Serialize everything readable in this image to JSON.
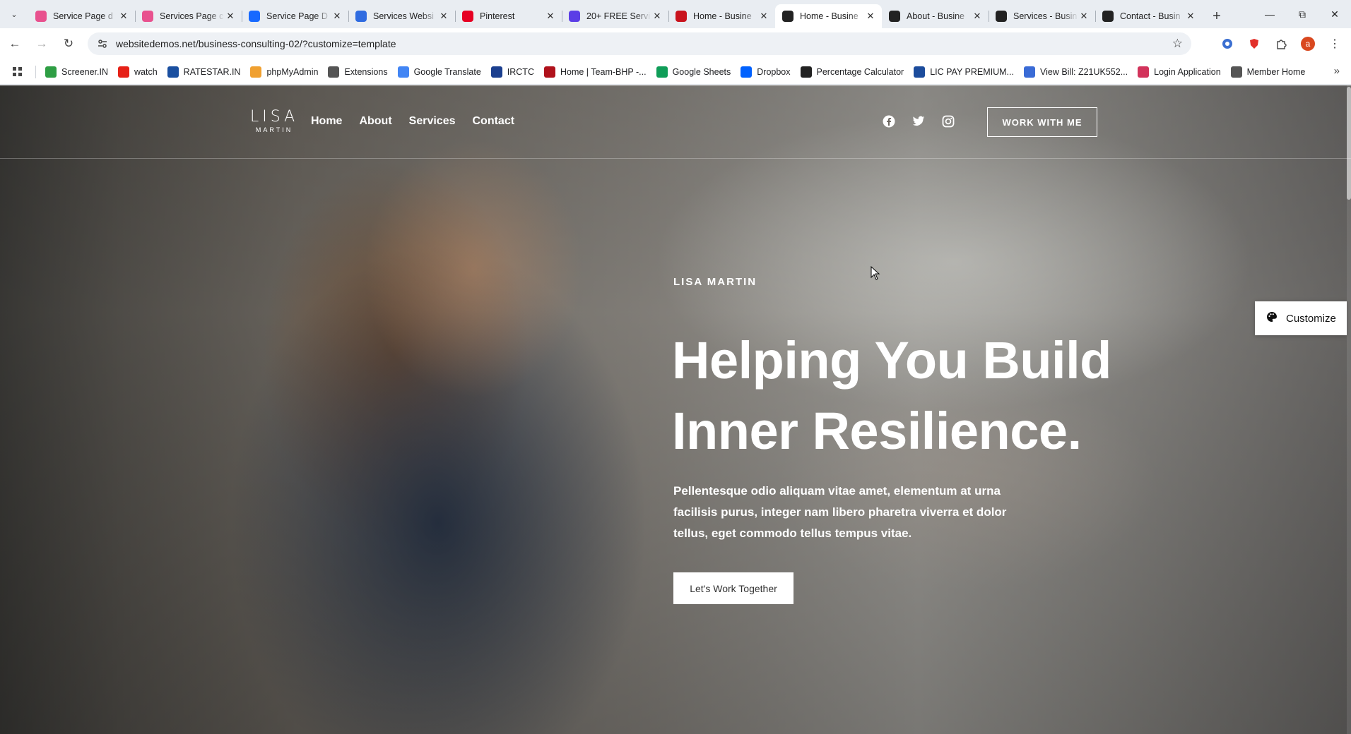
{
  "browser": {
    "tabs": [
      {
        "title": "Service Page d",
        "favicon_color": "#e8518e",
        "icon": "dribbble-icon"
      },
      {
        "title": "Services Page c",
        "favicon_color": "#e8518e",
        "icon": "dribbble-icon"
      },
      {
        "title": "Service Page D",
        "favicon_color": "#1769ff",
        "icon": "behance-icon"
      },
      {
        "title": "Services Websi",
        "favicon_color": "#2f6be0",
        "icon": "n-icon"
      },
      {
        "title": "Pinterest",
        "favicon_color": "#e60023",
        "icon": "pinterest-icon"
      },
      {
        "title": "20+ FREE Servi",
        "favicon_color": "#5b3ee6",
        "icon": "a-icon"
      },
      {
        "title": "Home - Busine",
        "favicon_color": "#c9131d",
        "icon": "n-red-icon"
      },
      {
        "title": "Home - Busine",
        "favicon_color": "#222222",
        "icon": "m-icon",
        "active": true
      },
      {
        "title": "About - Busine",
        "favicon_color": "#222222",
        "icon": "m-icon"
      },
      {
        "title": "Services - Busin",
        "favicon_color": "#222222",
        "icon": "m-icon"
      },
      {
        "title": "Contact - Busin",
        "favicon_color": "#222222",
        "icon": "m-icon"
      }
    ],
    "url": "websitedemos.net/business-consulting-02/?customize=template",
    "profile_initial": "a",
    "bookmarks": [
      {
        "label": "Screener.IN",
        "color": "#2e9e44"
      },
      {
        "label": "watch",
        "color": "#e62117"
      },
      {
        "label": "RATESTAR.IN",
        "color": "#1a4fa0"
      },
      {
        "label": "phpMyAdmin",
        "color": "#f0a030"
      },
      {
        "label": "Extensions",
        "color": "#555555"
      },
      {
        "label": "Google Translate",
        "color": "#4285f4"
      },
      {
        "label": "IRCTC",
        "color": "#1b3f8f"
      },
      {
        "label": "Home | Team-BHP -...",
        "color": "#b0121b"
      },
      {
        "label": "Google Sheets",
        "color": "#0f9d58"
      },
      {
        "label": "Dropbox",
        "color": "#0061fe"
      },
      {
        "label": "Percentage Calculator",
        "color": "#222222"
      },
      {
        "label": "LIC PAY PREMIUM...",
        "color": "#1c4c9c"
      },
      {
        "label": "View Bill: Z21UK552...",
        "color": "#3a6bd6"
      },
      {
        "label": "Login Application",
        "color": "#d2335b"
      },
      {
        "label": "Member Home",
        "color": "#555555"
      }
    ]
  },
  "site": {
    "logo_top": "LISA",
    "logo_bottom": "MARTIN",
    "nav": [
      "Home",
      "About",
      "Services",
      "Contact"
    ],
    "header_cta": "WORK WITH ME",
    "eyebrow": "LISA MARTIN",
    "headline": "Helping You Build Inner Resilience.",
    "lead": "Pellentesque odio aliquam vitae amet, elementum at urna facilisis purus, integer nam libero pharetra viverra et dolor tellus, eget commodo tellus tempus vitae.",
    "hero_cta": "Let's Work Together",
    "customize": "Customize"
  }
}
